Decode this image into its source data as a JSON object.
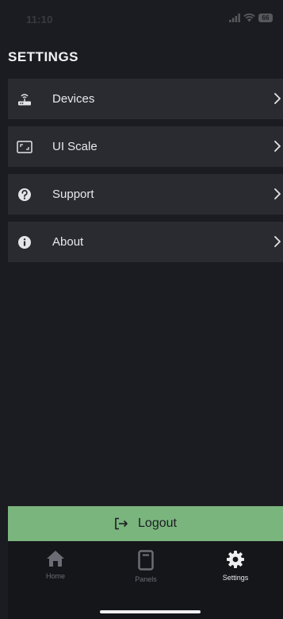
{
  "status_bar": {
    "time": "11:10",
    "battery": "66"
  },
  "page": {
    "title": "SETTINGS"
  },
  "menu": {
    "items": [
      {
        "label": "Devices",
        "icon": "router-icon"
      },
      {
        "label": "UI Scale",
        "icon": "scale-icon"
      },
      {
        "label": "Support",
        "icon": "question-icon"
      },
      {
        "label": "About",
        "icon": "info-icon"
      }
    ]
  },
  "logout": {
    "label": "Logout",
    "icon": "logout-icon"
  },
  "tabs": [
    {
      "label": "Home",
      "icon": "home-icon",
      "active": false
    },
    {
      "label": "Panels",
      "icon": "panel-icon",
      "active": false
    },
    {
      "label": "Settings",
      "icon": "gear-icon",
      "active": true
    }
  ],
  "colors": {
    "background": "#1b1c21",
    "row": "#2a2b31",
    "accent_green": "#7ab57e",
    "tabbar": "#15161a"
  }
}
